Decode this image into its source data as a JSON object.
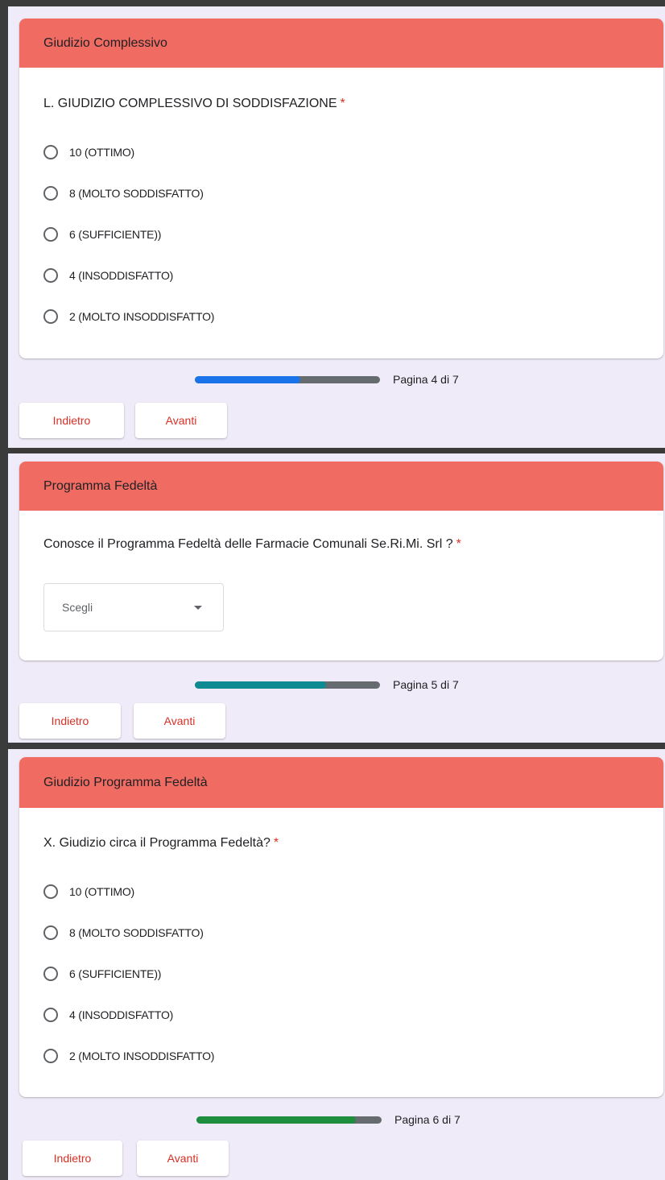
{
  "panels": [
    {
      "header": "Giudizio Complessivo",
      "question": "L. GIUDIZIO COMPLESSIVO DI SODDISFAZIONE",
      "required_mark": "*",
      "options": [
        "10 (OTTIMO)",
        "8 (MOLTO SODDISFATTO)",
        "6 (SUFFICIENTE))",
        "4 (INSODDISFATTO)",
        "2 (MOLTO INSODDISFATTO)"
      ],
      "progress": {
        "value": 0.57,
        "label": "Pagina 4 di 7",
        "color": "#1a73e8"
      },
      "back_label": "Indietro",
      "next_label": "Avanti"
    },
    {
      "header": "Programma Fedeltà",
      "question": "Conosce il Programma Fedeltà delle Farmacie Comunali Se.Ri.Mi. Srl ?",
      "required_mark": "*",
      "select_value": "Scegli",
      "progress": {
        "value": 0.71,
        "label": "Pagina 5 di 7",
        "color": "#0e8a92"
      },
      "back_label": "Indietro",
      "next_label": "Avanti"
    },
    {
      "header": "Giudizio Programma Fedeltà",
      "question": "X. Giudizio circa il Programma Fedeltà?",
      "required_mark": "*",
      "options": [
        "10 (OTTIMO)",
        "8 (MOLTO SODDISFATTO)",
        "6 (SUFFICIENTE))",
        "4 (INSODDISFATTO)",
        "2 (MOLTO INSODDISFATTO)"
      ],
      "progress": {
        "value": 0.86,
        "label": "Pagina 6 di 7",
        "color": "#1e8e3e"
      },
      "back_label": "Indietro",
      "next_label": "Avanti"
    }
  ],
  "colors": {
    "header_bg": "#f06b62",
    "page_bg": "#f0ebf8",
    "accent_text": "#d93025",
    "progress_track": "#666b70"
  }
}
